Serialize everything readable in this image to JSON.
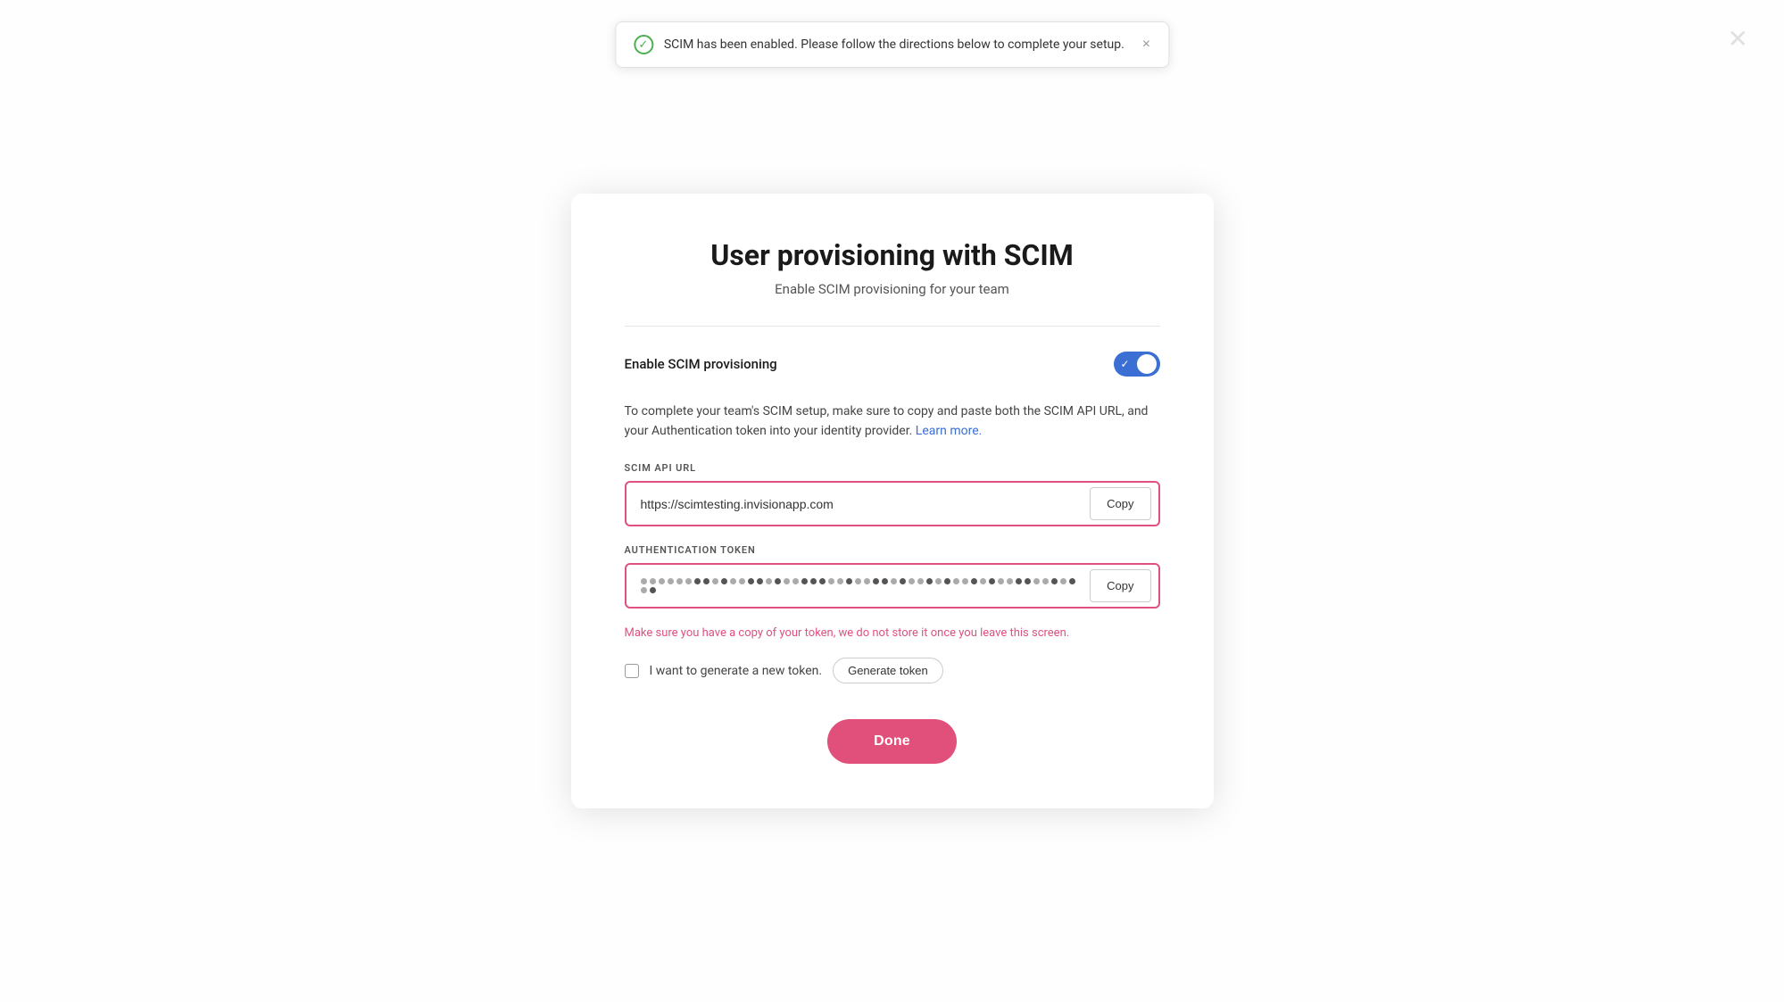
{
  "toast": {
    "message": "SCIM has been enabled. Please follow the directions below to complete your setup.",
    "close_label": "×"
  },
  "close_button_label": "✕",
  "page": {
    "title": "User provisioning with SCIM",
    "subtitle": "Enable SCIM provisioning for your team"
  },
  "toggle_row": {
    "label": "Enable SCIM provisioning",
    "enabled": true
  },
  "description": {
    "text_before_link": "To complete your team's SCIM setup, make sure to copy and paste both the SCIM API URL, and your Authentication token into your identity provider.",
    "link_text": "Learn more.",
    "link_href": "#"
  },
  "scim_api_url": {
    "label": "SCIM API URL",
    "value": "https://scimtesting.invisionapp.com",
    "copy_label": "Copy"
  },
  "auth_token": {
    "label": "Authentication token",
    "copy_label": "Copy"
  },
  "warning_text": "Make sure you have a copy of your token, we do not store it once you leave this screen.",
  "new_token": {
    "label": "I want to generate a new token.",
    "button_label": "Generate token"
  },
  "done_button": "Done"
}
